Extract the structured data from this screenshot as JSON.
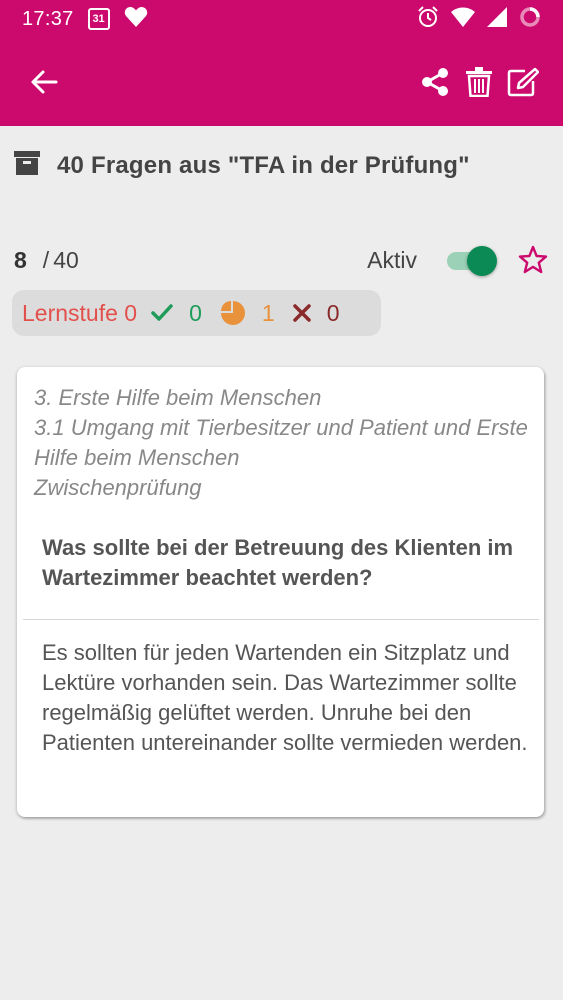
{
  "status_bar": {
    "time": "17:37",
    "calendar_day": "31",
    "icons": [
      "calendar-icon",
      "heart-icon",
      "alarm-icon",
      "wifi-icon",
      "signal-icon",
      "loading-icon"
    ]
  },
  "app_bar": {
    "color": "#cc0a6e",
    "icons": [
      "back-arrow-icon",
      "share-icon",
      "trash-icon",
      "edit-icon"
    ]
  },
  "header": {
    "title": "40 Fragen aus \"TFA in der Prüfung\""
  },
  "progress": {
    "current": "8",
    "separator": "/",
    "total": "40",
    "active_label": "Aktiv",
    "active": true
  },
  "level": {
    "label": "Lernstufe 0",
    "correct": "0",
    "partial": "1",
    "wrong": "0"
  },
  "card": {
    "category_lines": [
      "3. Erste Hilfe beim Menschen",
      "3.1 Umgang mit Tierbesitzer und Patient und Erste Hilfe beim Menschen",
      "Zwischenprüfung"
    ],
    "question": "Was sollte bei der Betreuung des Klienten im Wartezimmer beachtet werden?",
    "answer": "Es sollten für jeden Wartenden ein Sitzplatz und Lektüre vorhanden sein. Das Wartezimmer sollte regelmäßig gelüftet werden. Unruhe bei den Patienten untereinander sollte vermieden werden."
  },
  "colors": {
    "primary": "#cc0a6e",
    "toggle_on": "#0c8a56",
    "level_red": "#e2504c",
    "check_green": "#1f9c5a",
    "pie_orange": "#e8923c",
    "cross_red": "#8a2a2a"
  }
}
